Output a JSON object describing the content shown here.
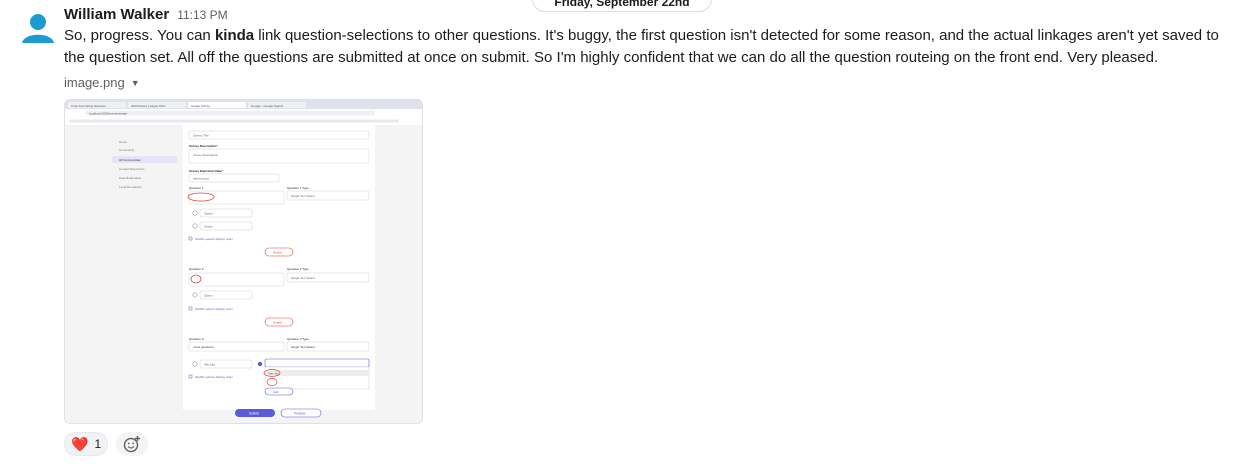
{
  "date_divider": "Friday, September 22nd",
  "message": {
    "author": "William Walker",
    "time": "11:13 PM",
    "text_before_bold": "So, progress. You can ",
    "text_bold": "kinda",
    "text_after_bold": " link question-selections to other questions. It's buggy, the first question isn't detected for some reason, and the actual linkages aren't yet saved to the question set. All off the questions are submitted at once on submit. So I'm highly confident that we can do all the question routeing on the front end. Very pleased.",
    "attachment_name": "image.png"
  },
  "screenshot": {
    "tabs": [
      "Crisp Formatting Discover",
      "2023 Rotary League MVC",
      "Create Survey",
      "Google - Google Search"
    ],
    "address": "localhost:3000/survey/create",
    "sidebar_items": [
      "Home",
      "Community",
      "All Communities",
      "Contact Directories",
      "Date Bookmarks",
      "Local Remainder"
    ],
    "survey_title_placeholder": "Survey Title",
    "survey_description_label": "Survey Description*",
    "survey_description_placeholder": "Survey Description",
    "expiration_label": "Survey Expiration Date*",
    "expiration_placeholder": "dd/mm/yyyy",
    "q1_label": "Question 1",
    "q1_type_label": "Question 1 Type",
    "q2_label": "Question 2",
    "q2_type_label": "Question 2 Type",
    "q3_label": "Question 3",
    "q3_type_label": "Question 3 Type",
    "q3_value": "I love questions",
    "type_value": "Single Text Select",
    "option_placeholder": "Option",
    "option_value": "Yes I do",
    "shuffle_label": "Shuffle options display order",
    "delete_label": "Delete",
    "add_label": "Add",
    "submit_label": "Submit",
    "preview_label": "Preview"
  },
  "reactions": [
    {
      "emoji": "❤️",
      "count": "1"
    }
  ],
  "colors": {
    "accent": "#5b5bd6",
    "annotation": "#e0443e",
    "link": "#1264a3"
  }
}
